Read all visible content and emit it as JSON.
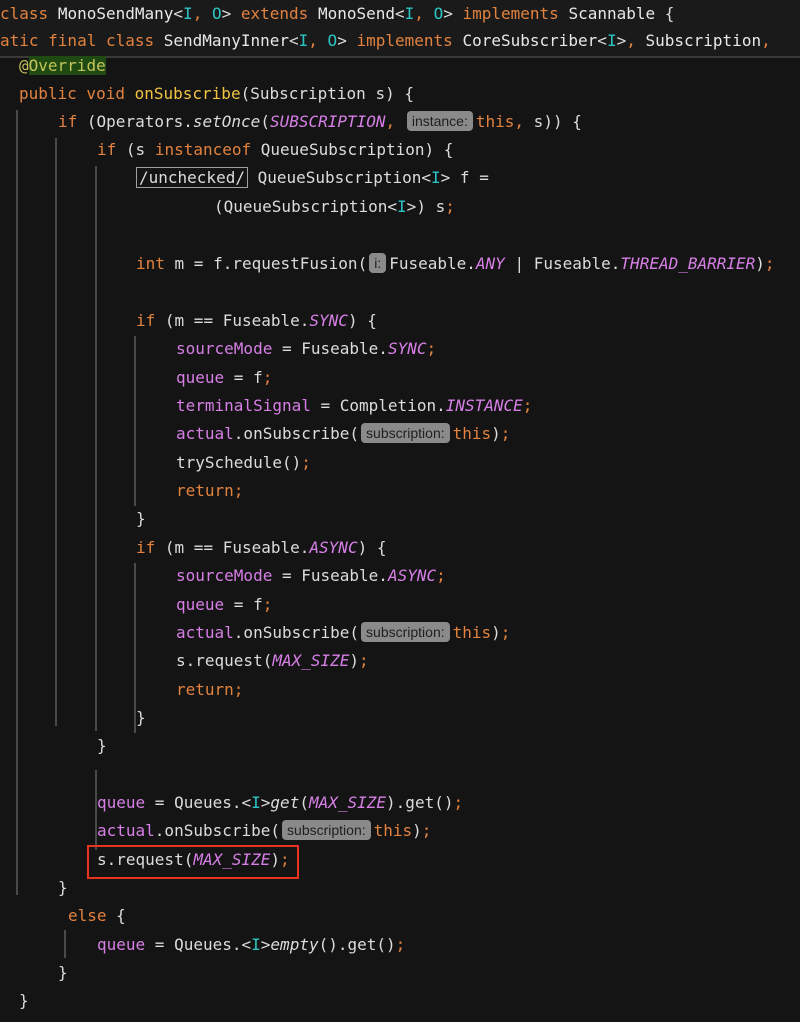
{
  "editor": {
    "sticky_header": {
      "line1": {
        "kw_class": "class",
        "name": "MonoSendMany",
        "lt": "<",
        "tp1": "I",
        "comma": ", ",
        "tp2": "O",
        "gt": ">",
        "kw_extends": "extends",
        "parent": "MonoSend",
        "kw_implements": "implements",
        "iface": "Scannable",
        "brace": "{"
      },
      "line2": {
        "prefix": "atic final class",
        "name": "SendManyInner",
        "kw_implements": "implements",
        "iface1": "CoreSubscriber",
        "iface2": "Subscription",
        "trailing": ","
      }
    },
    "annotation": {
      "at": "@",
      "name": "Override"
    },
    "method_signature": {
      "modifiers": "public void",
      "name": "onSubscribe",
      "params": "(Subscription s) {"
    },
    "inlay_hints": {
      "instance": "instance:",
      "i": "i:",
      "subscription": "subscription:"
    },
    "code": {
      "if_kw": "if",
      "setonce_pre": "(Operators.",
      "setonce_fn": "setOnce",
      "setonce_const": "SUBSCRIPTION",
      "this_kw": "this",
      "setonce_post": " s)) {",
      "instanceof_pre": "(s ",
      "instanceof_kw": "instanceof",
      "instanceof_post": " QueueSubscription) {",
      "unchecked_marker": "/unchecked/",
      "qs_decl": "QueueSubscription",
      "f_assign": " f =",
      "cast_pre": "(QueueSubscription",
      "cast_post": ") s",
      "int_kw": "int",
      "request_fusion": " m = f.requestFusion(",
      "fuseable": "Fuseable.",
      "any": "ANY",
      "pipe": " | ",
      "thread_barrier": "THREAD_BARRIER",
      "cond_sync_pre": "(m == Fuseable.",
      "sync": "SYNC",
      "async": "ASYNC",
      "cond_post": ") {",
      "source_mode": "sourceMode",
      "queue": "queue",
      "f_val": " = f",
      "terminal_signal": "terminalSignal",
      "completion": " = Completion.",
      "instance_const": "INSTANCE",
      "actual": "actual",
      "on_subscribe_call": ".onSubscribe(",
      "close_paren": ")",
      "try_schedule": "trySchedule()",
      "return_kw": "return",
      "s_request": "s.request(",
      "max_size": "MAX_SIZE",
      "queues_pre": " = Queues.<",
      "get_fn": "get",
      "empty_fn": "empty",
      "get_call": ".get()",
      "else_kw": "else",
      "open_brace": "{",
      "close_brace": "}",
      "semicolon": ";"
    },
    "highlight": {
      "color": "#e8331e",
      "target_line": "s.request(MAX_SIZE);"
    }
  }
}
